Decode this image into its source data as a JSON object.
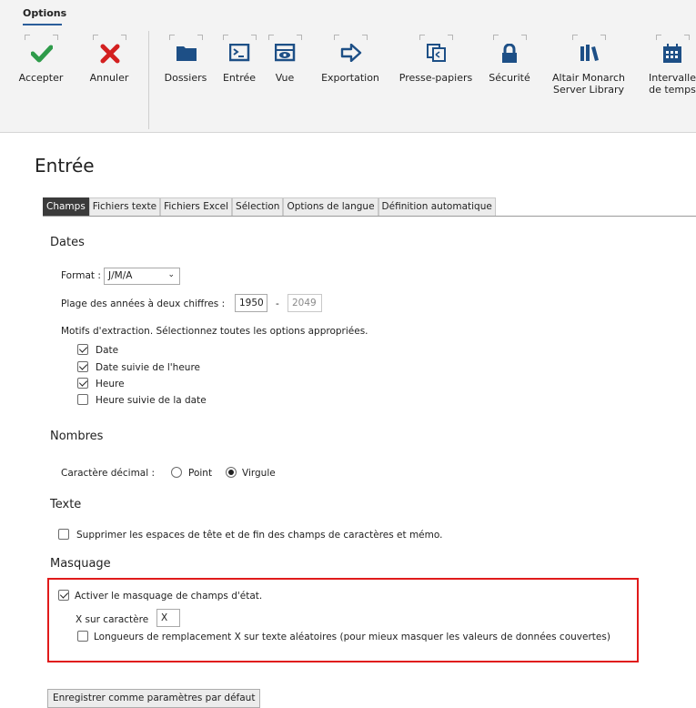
{
  "ribbon": {
    "tab_label": "Options",
    "buttons": [
      {
        "label": "Accepter",
        "icon": "check-icon",
        "color": "#2e9b4a"
      },
      {
        "label": "Annuler",
        "icon": "x-icon",
        "color": "#d32020"
      },
      {
        "label": "Dossiers",
        "icon": "folder-icon",
        "color": "#1d4f86"
      },
      {
        "label": "Entrée",
        "icon": "console-icon",
        "color": "#1d4f86"
      },
      {
        "label": "Vue",
        "icon": "view-icon",
        "color": "#1d4f86"
      },
      {
        "label": "Exportation",
        "icon": "export-arrow-icon",
        "color": "#1d4f86"
      },
      {
        "label": "Presse-papiers",
        "icon": "clipboard-icon",
        "color": "#1d4f86"
      },
      {
        "label": "Sécurité",
        "icon": "lock-icon",
        "color": "#1d4f86"
      },
      {
        "label": "Altair Monarch\nServer Library",
        "icon": "library-icon",
        "color": "#1d4f86"
      },
      {
        "label": "Intervalle\nde temps",
        "icon": "calendar-icon",
        "color": "#1d4f86"
      }
    ]
  },
  "page": {
    "title": "Entrée",
    "tabs": [
      "Champs",
      "Fichiers texte",
      "Fichiers Excel",
      "Sélection",
      "Options de langue",
      "Définition automatique"
    ],
    "active_tab": "Champs"
  },
  "dates": {
    "section_title": "Dates",
    "format_label": "Format :",
    "format_value": "J/M/A",
    "range_label": "Plage des années à deux chiffres :",
    "range_start": "1950",
    "range_sep": "-",
    "range_end": "2049",
    "patterns_label": "Motifs d'extraction. Sélectionnez toutes les options appropriées.",
    "patterns": [
      {
        "label": "Date",
        "checked": true
      },
      {
        "label": "Date suivie de l'heure",
        "checked": true
      },
      {
        "label": "Heure",
        "checked": true
      },
      {
        "label": "Heure suivie de la date",
        "checked": false
      }
    ]
  },
  "numbers": {
    "section_title": "Nombres",
    "decimal_label": "Caractère décimal :",
    "options": [
      {
        "label": "Point",
        "checked": false
      },
      {
        "label": "Virgule",
        "checked": true
      }
    ]
  },
  "text": {
    "section_title": "Texte",
    "trim_label": "Supprimer les espaces de tête et de fin des champs de caractères et mémo.",
    "trim_checked": false
  },
  "masking": {
    "section_title": "Masquage",
    "enable_label": "Activer le masquage de champs d'état.",
    "enable_checked": true,
    "x_char_label": "X sur caractère",
    "x_char_value": "X",
    "random_label": "Longueurs de remplacement X sur texte aléatoires (pour mieux masquer les valeurs de données couvertes)",
    "random_checked": false,
    "highlight_color": "#e01a1a"
  },
  "footer": {
    "save_default_label": "Enregistrer comme paramètres par défaut"
  }
}
